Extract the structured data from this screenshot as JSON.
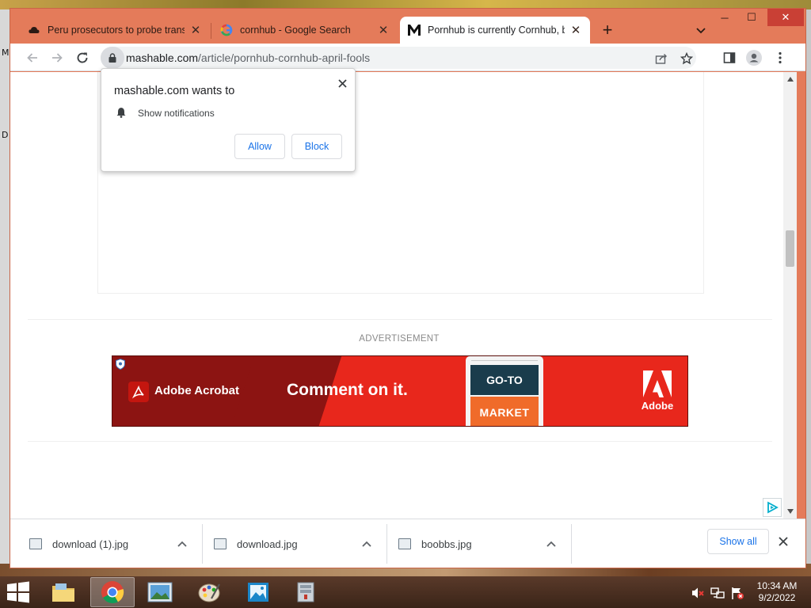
{
  "desktop": {
    "left_edge_letters": [
      "M",
      "D"
    ]
  },
  "window": {
    "tabs": [
      {
        "title": "Peru prosecutors to probe transg",
        "favicon": "cloud-icon",
        "active": false
      },
      {
        "title": "cornhub - Google Search",
        "favicon": "google-icon",
        "active": false
      },
      {
        "title": "Pornhub is currently Cornhub, bri",
        "favicon": "mashable-icon",
        "active": true
      }
    ],
    "controls": {
      "minimize": "─",
      "maximize": "☐",
      "close": "✕"
    }
  },
  "toolbar": {
    "url_domain": "mashable.com",
    "url_path": "/article/pornhub-cornhub-april-fools"
  },
  "permission_prompt": {
    "title": "mashable.com wants to",
    "permission": "Show notifications",
    "allow_label": "Allow",
    "block_label": "Block"
  },
  "page": {
    "advertisement_label": "ADVERTISEMENT",
    "ad": {
      "brand": "Adobe Acrobat",
      "headline": "Comment on it.",
      "phone_top": "GO-TO",
      "phone_bottom": "MARKET",
      "logo_word": "Adobe",
      "colors": {
        "red": "#e8271c",
        "dark_red": "#8c1412",
        "navy": "#1a3c4c",
        "orange": "#f06b2a"
      }
    }
  },
  "downloads": {
    "items": [
      {
        "name": "download (1).jpg"
      },
      {
        "name": "download.jpg"
      },
      {
        "name": "boobbs.jpg"
      }
    ],
    "show_all_label": "Show all"
  },
  "taskbar": {
    "apps": [
      "file-explorer-icon",
      "chrome-icon",
      "photo-viewer-icon",
      "paint-icon",
      "photos-icon",
      "archive-icon"
    ],
    "active_app": "chrome-icon",
    "time": "10:34 AM",
    "date": "9/2/2022"
  },
  "colors": {
    "frame": "#e47b5a",
    "link_blue": "#1a73e8",
    "close_red": "#c94035"
  }
}
